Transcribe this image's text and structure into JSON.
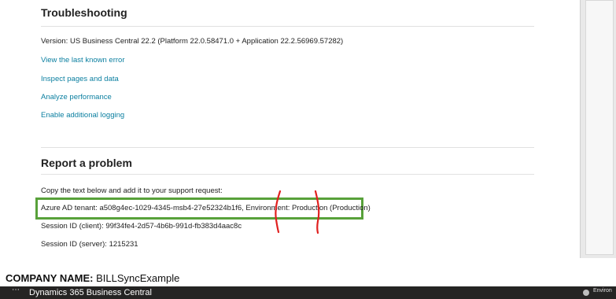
{
  "troubleshooting": {
    "heading": "Troubleshooting",
    "version": "Version: US Business Central 22.2 (Platform 22.0.58471.0 + Application 22.2.56969.57282)",
    "links": [
      "View the last known error",
      "Inspect pages and data",
      "Analyze performance",
      "Enable additional logging"
    ]
  },
  "report": {
    "heading": "Report a problem",
    "instruction": "Copy the text below and add it to your support request:",
    "tenant_line": "Azure AD tenant: a508g4ec-1029-4345-msb4-27e52324b1f6, Environment: Production (Production)",
    "session_client": "Session ID (client): 99f34fe4-2d57-4b6b-991d-fb383d4aac8c",
    "session_server": "Session ID (server): 1215231"
  },
  "company": {
    "label": "COMPANY NAME:",
    "value": "BILLSyncExample"
  },
  "appbar": {
    "waffle": "⋯",
    "title": "Dynamics 365 Business Central",
    "env_label": "Environ"
  },
  "colors": {
    "link": "#0b7fa0",
    "highlight_box": "#58a13a",
    "annotation": "#e0201f",
    "appbar": "#252423"
  }
}
